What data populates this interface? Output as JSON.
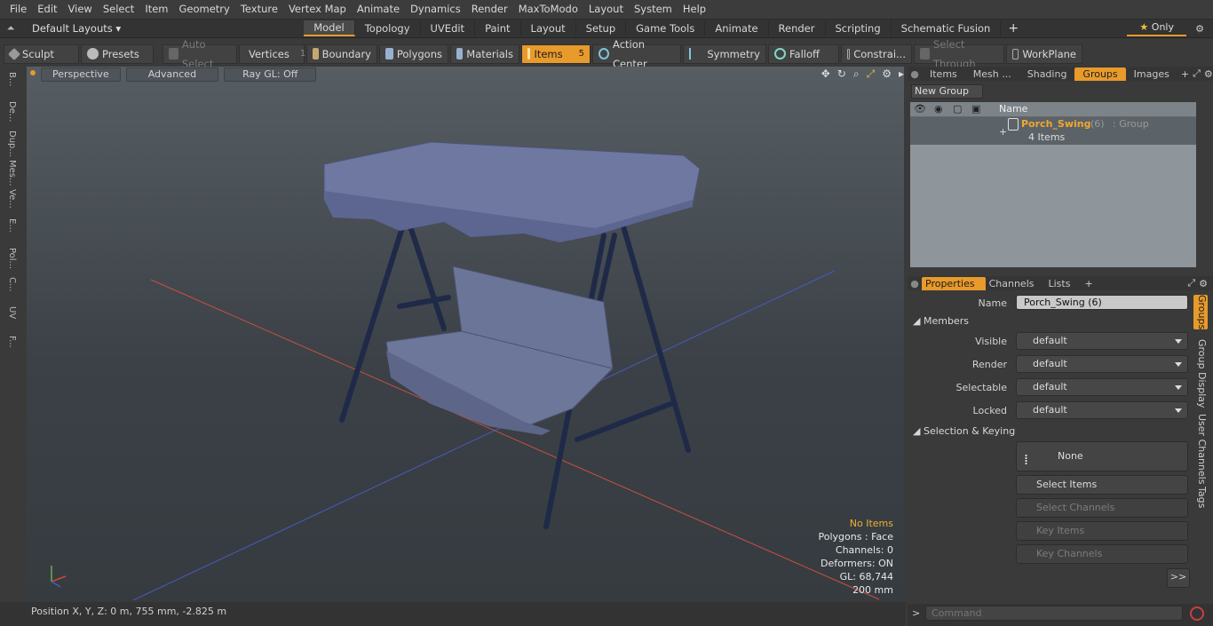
{
  "menu": [
    "File",
    "Edit",
    "View",
    "Select",
    "Item",
    "Geometry",
    "Texture",
    "Vertex Map",
    "Animate",
    "Dynamics",
    "Render",
    "MaxToModo",
    "Layout",
    "System",
    "Help"
  ],
  "layout_selector": "Default Layouts",
  "layout_tabs": [
    {
      "label": "Model",
      "active": true
    },
    {
      "label": "Topology"
    },
    {
      "label": "UVEdit"
    },
    {
      "label": "Paint"
    },
    {
      "label": "Layout"
    },
    {
      "label": "Setup"
    },
    {
      "label": "Game Tools"
    },
    {
      "label": "Animate"
    },
    {
      "label": "Render"
    },
    {
      "label": "Scripting"
    },
    {
      "label": "Schematic Fusion"
    }
  ],
  "only_label": "Only",
  "toolbar": {
    "sculpt": "Sculpt",
    "presets": "Presets",
    "auto_select": "Auto Select",
    "vertices": "Vertices",
    "vertices_count": "1",
    "boundary": "Boundary",
    "polygons": "Polygons",
    "materials": "Materials",
    "items": "Items",
    "items_count": "5",
    "action_center": "Action Center",
    "symmetry": "Symmetry",
    "falloff": "Falloff",
    "constraints": "Constrai...",
    "select_through": "Select Through",
    "workplane": "WorkPlane"
  },
  "left_tabs": [
    "B...",
    "De...",
    "Dup...",
    "Mes...",
    "Ve...",
    "E...",
    "Pol...",
    "C...",
    "UV",
    "F..."
  ],
  "viewport": {
    "perspective": "Perspective",
    "advanced": "Advanced",
    "raygl": "Ray GL: Off",
    "stats": {
      "no_items": "No Items",
      "polygons": "Polygons : Face",
      "channels": "Channels: 0",
      "deformers": "Deformers: ON",
      "gl": "GL: 68,744",
      "scale": "200 mm"
    }
  },
  "status": {
    "position": "Position X, Y, Z:   0 m, 755 mm, -2.825 m"
  },
  "right_top_tabs": [
    {
      "label": "Items"
    },
    {
      "label": "Mesh ..."
    },
    {
      "label": "Shading"
    },
    {
      "label": "Groups",
      "active": true
    },
    {
      "label": "Images"
    }
  ],
  "groups": {
    "new_group": "New Group",
    "col_name": "Name",
    "row": {
      "name": "Porch_Swing",
      "count": "(6)",
      "type": ": Group",
      "sub": "4 Items"
    }
  },
  "right_bottom_tabs": [
    {
      "label": "Properties",
      "active": true
    },
    {
      "label": "Channels"
    },
    {
      "label": "Lists"
    }
  ],
  "properties": {
    "name_label": "Name",
    "name_value": "Porch_Swing (6)",
    "members": "Members",
    "visible_label": "Visible",
    "render_label": "Render",
    "selectable_label": "Selectable",
    "locked_label": "Locked",
    "default_value": "default",
    "selection_keying": "Selection & Keying",
    "none": "None",
    "select_items": "Select Items",
    "select_channels": "Select Channels",
    "key_items": "Key Items",
    "key_channels": "Key Channels",
    "more": ">>"
  },
  "side_tabs": [
    "Groups",
    "Group Display",
    "User Channels",
    "Tags"
  ],
  "command_placeholder": "Command",
  "colors": {
    "accent": "#e89a2b",
    "accent_text": "#f0a830",
    "viewport_bg": "#454b51"
  }
}
